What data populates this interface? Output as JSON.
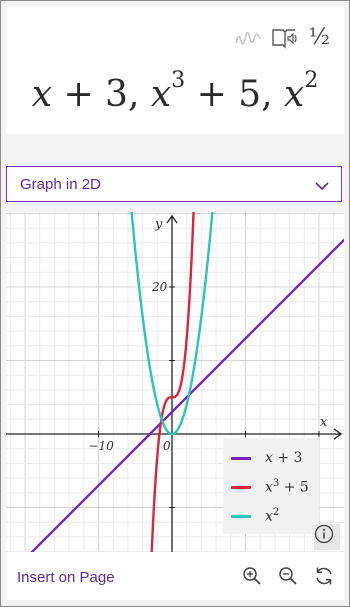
{
  "toolbar": {
    "ink_icon": "ink-replay-icon",
    "reader_icon": "immersive-reader-icon",
    "fraction_label": "½"
  },
  "expression": {
    "term1_var": "x",
    "term1_rest": " + 3, ",
    "term2_var": "x",
    "term2_exp": "3",
    "term2_rest": " + 5, ",
    "term3_var": "x",
    "term3_exp": "2"
  },
  "graph_mode": {
    "selected": "Graph in 2D"
  },
  "graph": {
    "x_axis_label": "x",
    "y_axis_label": "y",
    "tick_labels": {
      "x_neg10": "−10",
      "origin": "0",
      "y_20": "20"
    },
    "legend": [
      {
        "var": "x",
        "exp": "",
        "rest": " + 3",
        "color": "#7a1fbf"
      },
      {
        "var": "x",
        "exp": "3",
        "rest": " + 5",
        "color": "#d7263d"
      },
      {
        "var": "x",
        "exp": "2",
        "rest": "",
        "color": "#2ec4b6"
      }
    ],
    "info_icon": "info-icon"
  },
  "chart_data": {
    "type": "line",
    "title": "",
    "xlabel": "x",
    "ylabel": "y",
    "xlim": [
      -22,
      24
    ],
    "ylim": [
      -16,
      30
    ],
    "grid": true,
    "legend_position": "bottom-right",
    "series": [
      {
        "name": "x + 3",
        "color": "#7a1fbf",
        "fn": "linear"
      },
      {
        "name": "x³ + 5",
        "color": "#d7263d",
        "fn": "cubic"
      },
      {
        "name": "x²",
        "color": "#2ec4b6",
        "fn": "square"
      }
    ]
  },
  "footer": {
    "insert_label": "Insert on Page",
    "zoom_in_icon": "zoom-in-icon",
    "zoom_out_icon": "zoom-out-icon",
    "refresh_icon": "refresh-icon"
  }
}
